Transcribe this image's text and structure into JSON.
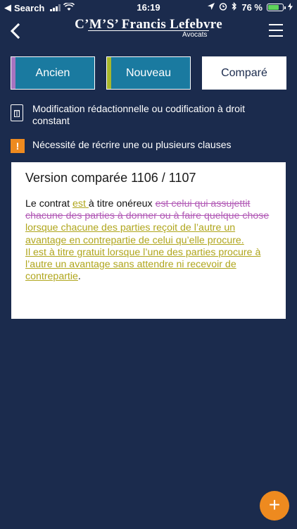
{
  "status_bar": {
    "carrier": "Search",
    "time": "16:19",
    "battery": "76 %"
  },
  "header": {
    "brand": "C’M’S’ Francis Lefebvre",
    "subtitle": "Avocats",
    "back_icon": "chevron-left-icon",
    "menu_icon": "hamburger-icon"
  },
  "tabs": [
    {
      "label": "Ancien",
      "color": "#a774bf",
      "active": false
    },
    {
      "label": "Nouveau",
      "color": "#a8b72b",
      "active": false
    },
    {
      "label": "Comparé",
      "active": true
    }
  ],
  "legend": {
    "editorial": "Modification rédactionnelle ou codification à droit constant",
    "rewrite": "Nécessité de récrire une ou plusieurs clauses",
    "editorial_icon": "document-t-icon",
    "rewrite_icon": "warning-icon",
    "warning_mark": "!"
  },
  "comparison": {
    "title": "Version comparée 1106 / 1107",
    "segments": [
      {
        "type": "plain",
        "text": "Le contrat "
      },
      {
        "type": "ins",
        "text": "est "
      },
      {
        "type": "plain",
        "text": "à titre onéreux "
      },
      {
        "type": "del",
        "text": "est celui qui assujettit chacune des parties à donner ou à faire quelque chose"
      },
      {
        "type": "plain",
        "text": " "
      },
      {
        "type": "ins",
        "text": "lorsque chacune des parties reçoit de l’autre un avantage en contrepartie de celui qu’elle procure."
      },
      {
        "type": "plain",
        "text": " "
      },
      {
        "type": "ins",
        "text": "Il est à titre gratuit lorsque l’une des parties procure à l’autre un avantage sans attendre ni recevoir de contrepartie"
      },
      {
        "type": "plain",
        "text": "."
      }
    ]
  },
  "fab": {
    "label": "+",
    "icon": "plus-icon",
    "color": "#ee8a1f"
  }
}
